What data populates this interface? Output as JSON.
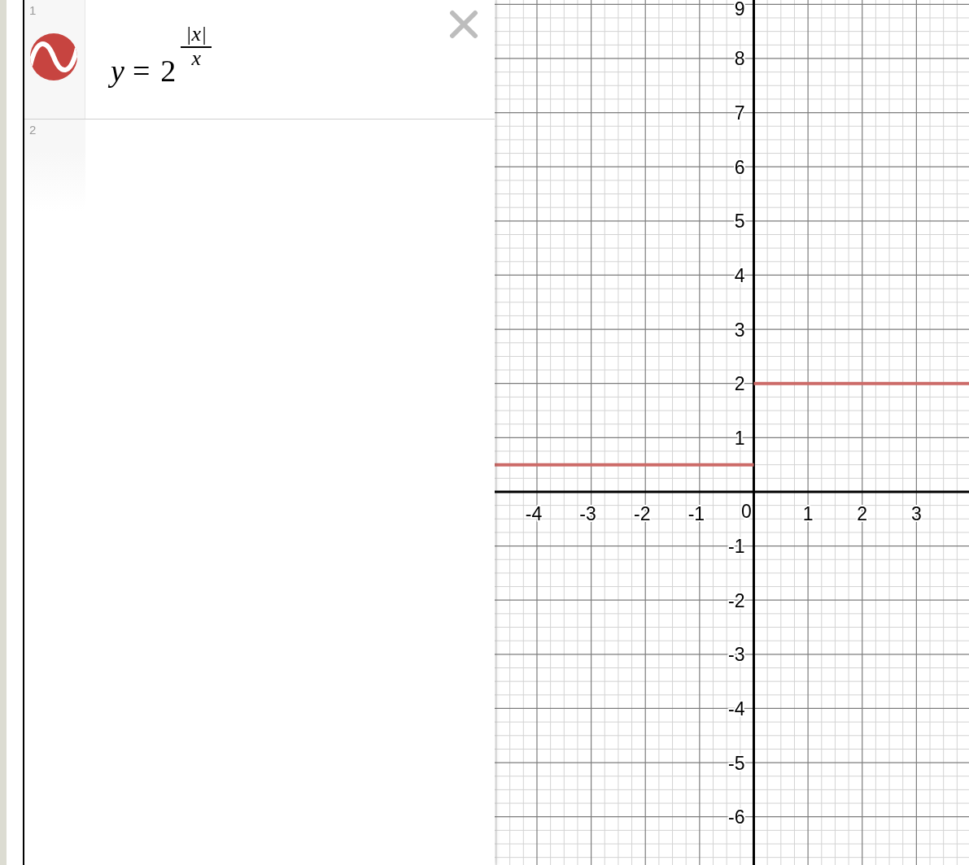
{
  "expressions": [
    {
      "kind": "expression",
      "number": "1",
      "color": "#c74440",
      "math": {
        "lhs": "y",
        "relation": "=",
        "base": "2",
        "exponent": {
          "numerator": "|x|",
          "denominator": "x"
        }
      }
    },
    {
      "kind": "blank",
      "number": "2"
    }
  ],
  "graph": {
    "chart_data": {
      "type": "line",
      "x": [
        -4.78,
        0,
        3.97
      ],
      "series": [
        {
          "color": "#cc6b68",
          "values": [
            0.5,
            0.5,
            null
          ]
        },
        {
          "color": "#cc6b68",
          "values": [
            null,
            2,
            2
          ]
        }
      ],
      "xlim": [
        -4.78,
        3.97
      ],
      "ylim": [
        -6.89,
        9.08
      ],
      "xticks": [
        -4,
        -3,
        -2,
        -1,
        0,
        1,
        2,
        3
      ],
      "yticks": [
        -6,
        -5,
        -4,
        -3,
        -2,
        -1,
        1,
        2,
        3,
        4,
        5,
        6,
        7,
        8,
        9
      ],
      "grid": true
    }
  }
}
